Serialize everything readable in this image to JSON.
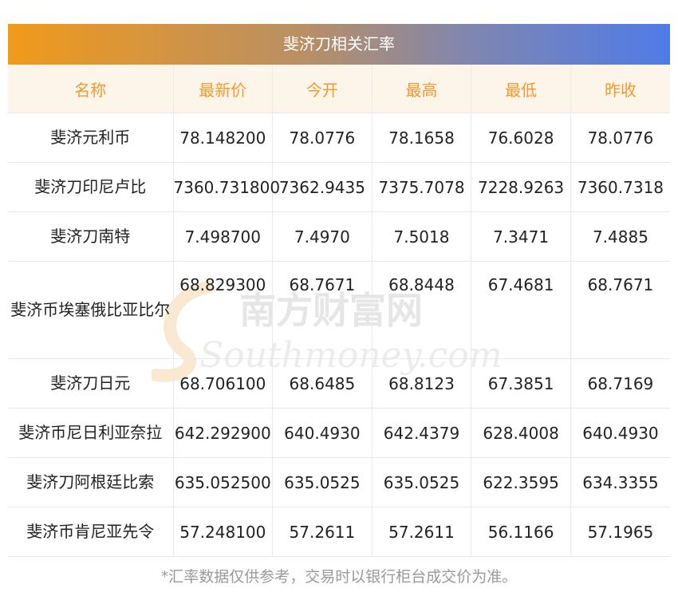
{
  "title": "斐济刀相关汇率",
  "headers": [
    "名称",
    "最新价",
    "今开",
    "最高",
    "最低",
    "昨收"
  ],
  "rows": [
    {
      "name": "斐济元利币",
      "latest": "78.148200",
      "open": "78.0776",
      "high": "78.1658",
      "low": "76.6028",
      "prev_close": "78.0776"
    },
    {
      "name": "斐济刀印尼卢比",
      "latest": "7360.731800",
      "open": "7362.9435",
      "high": "7375.7078",
      "low": "7228.9263",
      "prev_close": "7360.7318"
    },
    {
      "name": "斐济刀南特",
      "latest": "7.498700",
      "open": "7.4970",
      "high": "7.5018",
      "low": "7.3471",
      "prev_close": "7.4885"
    },
    {
      "name": "斐济币埃塞俄比亚比尔",
      "latest": "68.829300",
      "open": "68.7671",
      "high": "68.8448",
      "low": "67.4681",
      "prev_close": "68.7671"
    },
    {
      "name": "斐济刀日元",
      "latest": "68.706100",
      "open": "68.6485",
      "high": "68.8123",
      "low": "67.3851",
      "prev_close": "68.7169"
    },
    {
      "name": "斐济币尼日利亚奈拉",
      "latest": "642.292900",
      "open": "640.4930",
      "high": "642.4379",
      "low": "628.4008",
      "prev_close": "640.4930"
    },
    {
      "name": "斐济刀阿根廷比索",
      "latest": "635.052500",
      "open": "635.0525",
      "high": "635.0525",
      "low": "622.3595",
      "prev_close": "634.3355"
    },
    {
      "name": "斐济币肯尼亚先令",
      "latest": "57.248100",
      "open": "57.2611",
      "high": "57.2611",
      "low": "56.1166",
      "prev_close": "57.1965"
    }
  ],
  "watermark": {
    "cn": "南方财富网",
    "en": "Southmoney.com"
  },
  "footnote": "*汇率数据仅供参考，交易时以银行柜台成交价为准。",
  "colors": {
    "header_text": "#f2992e",
    "header_bg": "#fdf5ea",
    "gradient_start": "#f19a1a",
    "gradient_end": "#4f7be8"
  }
}
